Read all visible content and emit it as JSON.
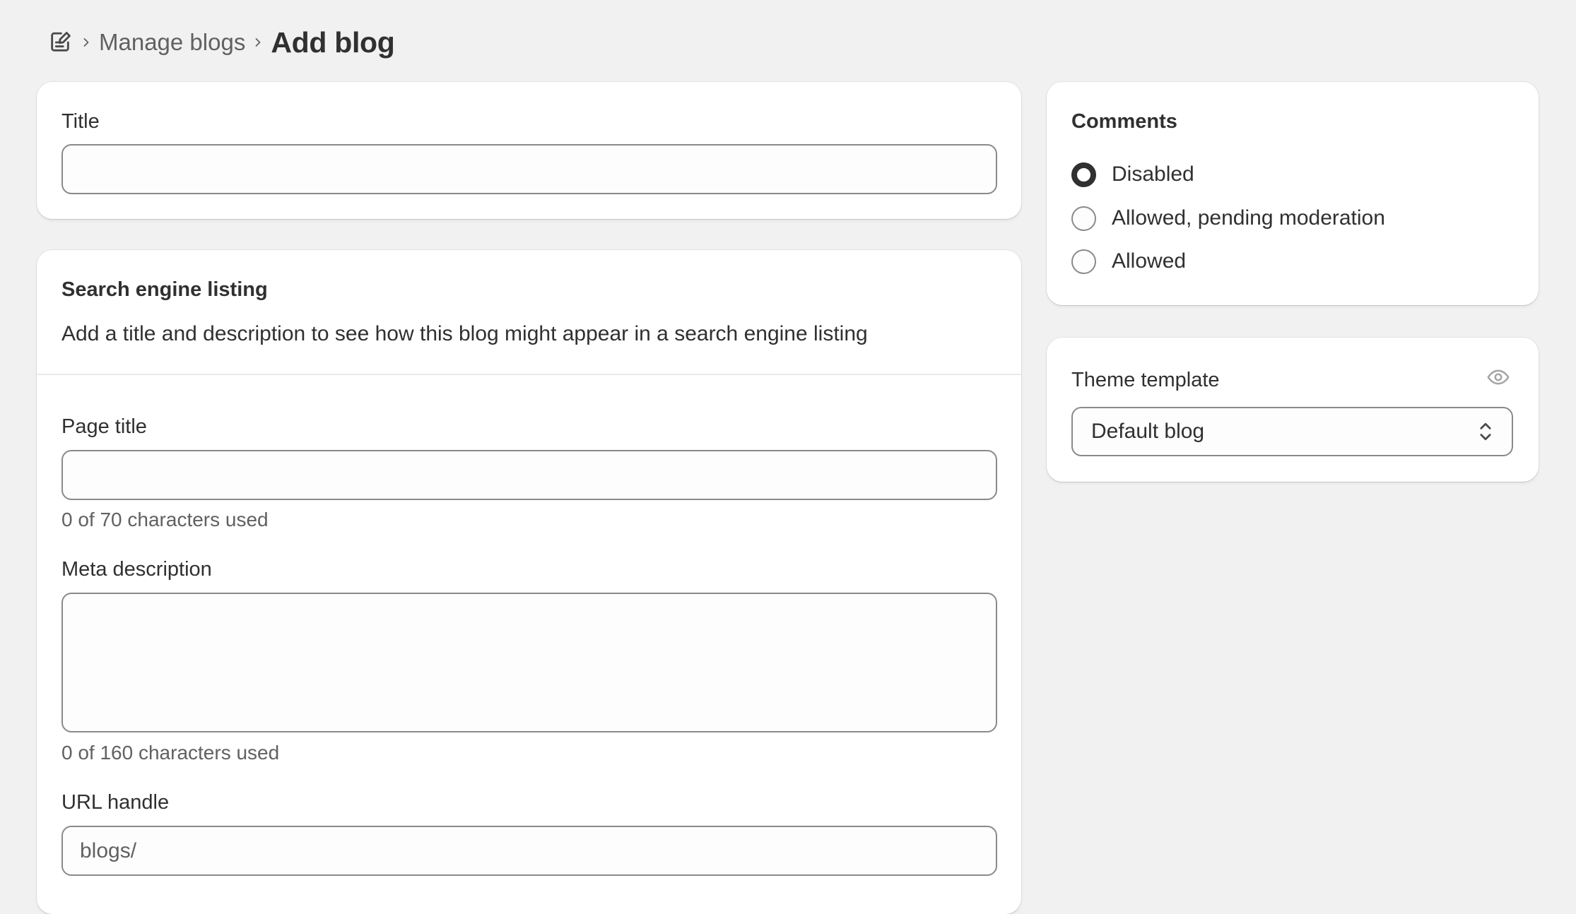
{
  "breadcrumb": {
    "icon": "blog-edit-icon",
    "parent_label": "Manage blogs",
    "current_label": "Add blog"
  },
  "title_card": {
    "label": "Title",
    "value": "",
    "placeholder": ""
  },
  "seo_card": {
    "heading": "Search engine listing",
    "description": "Add a title and description to see how this blog might appear in a search engine listing",
    "page_title": {
      "label": "Page title",
      "value": "",
      "help": "0 of 70 characters used"
    },
    "meta_description": {
      "label": "Meta description",
      "value": "",
      "help": "0 of 160 characters used"
    },
    "url_handle": {
      "label": "URL handle",
      "prefix": "blogs/",
      "value": ""
    }
  },
  "comments_card": {
    "heading": "Comments",
    "options": [
      {
        "label": "Disabled",
        "checked": true
      },
      {
        "label": "Allowed, pending moderation",
        "checked": false
      },
      {
        "label": "Allowed",
        "checked": false
      }
    ]
  },
  "theme_card": {
    "label": "Theme template",
    "preview_icon": "eye-icon",
    "selected": "Default blog"
  },
  "colors": {
    "background": "#f1f1f1",
    "card": "#ffffff",
    "text": "#303030",
    "subdued": "#616161",
    "border": "#8a8a8a"
  }
}
